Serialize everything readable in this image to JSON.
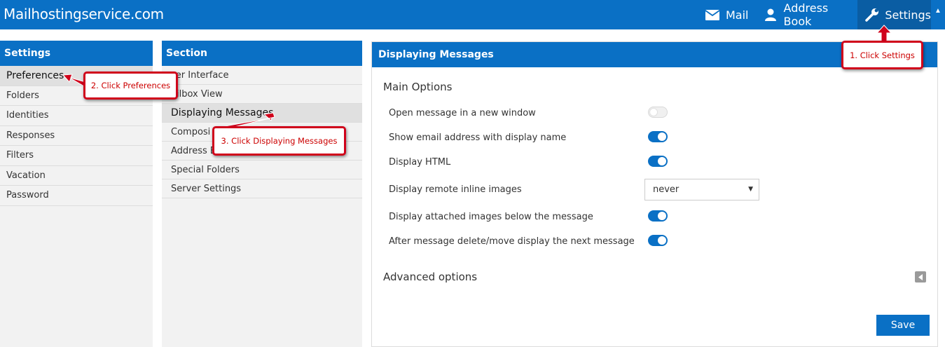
{
  "brand": "Mailhostingservice.com",
  "topnav": {
    "mail": "Mail",
    "address_book": "Address Book",
    "settings": "Settings"
  },
  "settings_panel": {
    "title": "Settings",
    "items": [
      "Preferences",
      "Folders",
      "Identities",
      "Responses",
      "Filters",
      "Vacation",
      "Password"
    ],
    "selected": "Preferences"
  },
  "section_panel": {
    "title": "Section",
    "items": [
      "User Interface",
      "Mailbox View",
      "Displaying Messages",
      "Composing Messages",
      "Address Book",
      "Special Folders",
      "Server Settings"
    ],
    "visible_items": [
      "ser Interface",
      "ailbox View",
      "Displaying Messages",
      "Composi",
      "Address B",
      "Special Folders",
      "Server Settings"
    ],
    "selected": "Displaying Messages"
  },
  "content": {
    "title": "Displaying Messages",
    "main_options_title": "Main Options",
    "options": [
      {
        "label": "Open message in a new window",
        "type": "toggle",
        "value": false
      },
      {
        "label": "Show email address with display name",
        "type": "toggle",
        "value": true
      },
      {
        "label": "Display HTML",
        "type": "toggle",
        "value": true
      },
      {
        "label": "Display remote inline images",
        "type": "select",
        "value": "never"
      },
      {
        "label": "Display attached images below the message",
        "type": "toggle",
        "value": true
      },
      {
        "label": "After message delete/move display the next message",
        "type": "toggle",
        "value": true
      }
    ],
    "advanced_title": "Advanced options",
    "save_label": "Save"
  },
  "callouts": {
    "step1": "1. Click Settings",
    "step2": "2. Click Preferences",
    "step3": "3. Click Displaying Messages"
  },
  "colors": {
    "primary": "#0a70c5",
    "primary_dark": "#0a5da3",
    "callout_red": "#d0021b"
  }
}
